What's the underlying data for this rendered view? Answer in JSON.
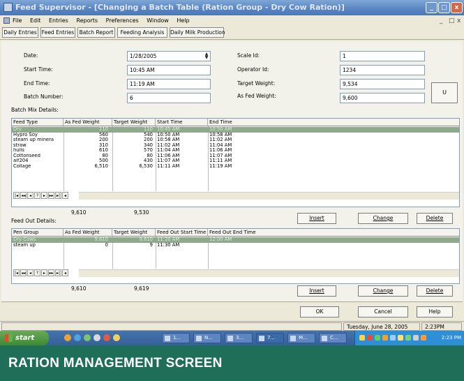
{
  "window": {
    "title": "Feed Supervisor - [Changing a Batch Table (Ration Group - Dry Cow Ration)]",
    "controls": [
      "_",
      "□",
      "x"
    ]
  },
  "menu": [
    "File",
    "Edit",
    "Entries",
    "Reports",
    "Preferences",
    "Window",
    "Help"
  ],
  "mdi_controls": [
    "_",
    "□",
    "x"
  ],
  "toolbar_tabs": [
    "Daily Entries",
    "Feed Entries",
    "Batch Report",
    "Feeding Analysis",
    "Daily Milk Production"
  ],
  "form": {
    "date_label": "Date:",
    "date_value": "1/28/2005",
    "start_time_label": "Start Time:",
    "start_time_value": "10:45 AM",
    "end_time_label": "End Time:",
    "end_time_value": "11:19 AM",
    "batch_number_label": "Batch Number:",
    "batch_number_value": "6",
    "scale_id_label": "Scale Id:",
    "scale_id_value": "1",
    "operator_id_label": "Operator Id:",
    "operator_id_value": "1234",
    "target_weight_label": "Target Weight:",
    "target_weight_value": "9,534",
    "as_fed_weight_label": "As Fed Weight:",
    "as_fed_weight_value": "9,600",
    "u_button": "U"
  },
  "batch_mix": {
    "section_label": "Batch Mix Details:",
    "columns": [
      "Feed Type",
      "As Fed Weight",
      "Target Weight",
      "Start Time",
      "End Time"
    ],
    "rows": [
      [
        "Dry",
        "110",
        "110",
        "10:45 AM",
        "10:50 AM"
      ],
      [
        "Hypro Soy",
        "560",
        "540",
        "10:50 AM",
        "10:58 AM"
      ],
      [
        "steam up minera",
        "200",
        "200",
        "10:58 AM",
        "11:02 AM"
      ],
      [
        "straw",
        "310",
        "340",
        "11:02 AM",
        "11:04 AM"
      ],
      [
        "hulls",
        "610",
        "570",
        "11:04 AM",
        "11:06 AM"
      ],
      [
        "Cottonseed",
        "80",
        "80",
        "11:06 AM",
        "11:07 AM"
      ],
      [
        "alf204",
        "500",
        "430",
        "11:07 AM",
        "11:11 AM"
      ],
      [
        "Collage",
        "6,510",
        "6,530",
        "11:11 AM",
        "11:19 AM"
      ]
    ],
    "selected_row": 0,
    "total_as_fed": "9,610",
    "total_target": "9,530"
  },
  "feed_out": {
    "section_label": "Feed Out Details:",
    "columns": [
      "Pen Group",
      "As Fed Weight",
      "Target Weight",
      "Feed Out Start Time",
      "Feed Out End Time"
    ],
    "rows": [
      [
        "Dry Cows",
        "9,610",
        "9,610",
        "11:20 AM",
        "12:00 AM"
      ],
      [
        "steam up",
        "0",
        "9",
        "11:30 AM",
        ""
      ]
    ],
    "selected_row": 0,
    "total_as_fed": "9,610",
    "total_target": "9,619"
  },
  "nav_glyphs": [
    "|◂",
    "◂◂",
    "◂",
    "?",
    "▸",
    "▸▸",
    "▸|"
  ],
  "row_buttons": {
    "insert": "Insert",
    "change": "Change",
    "delete": "Delete"
  },
  "dialog_buttons": {
    "ok": "OK",
    "cancel": "Cancel",
    "help": "Help"
  },
  "status": {
    "date": "Tuesday, June 28, 2005",
    "time": "2:23PM"
  },
  "taskbar": {
    "start": "start",
    "tasks": [
      "1...",
      "N...",
      "3...",
      "7...",
      "M...",
      "C..."
    ],
    "clock": "2:23 PM"
  },
  "caption": "RATION MANAGEMENT SCREEN"
}
